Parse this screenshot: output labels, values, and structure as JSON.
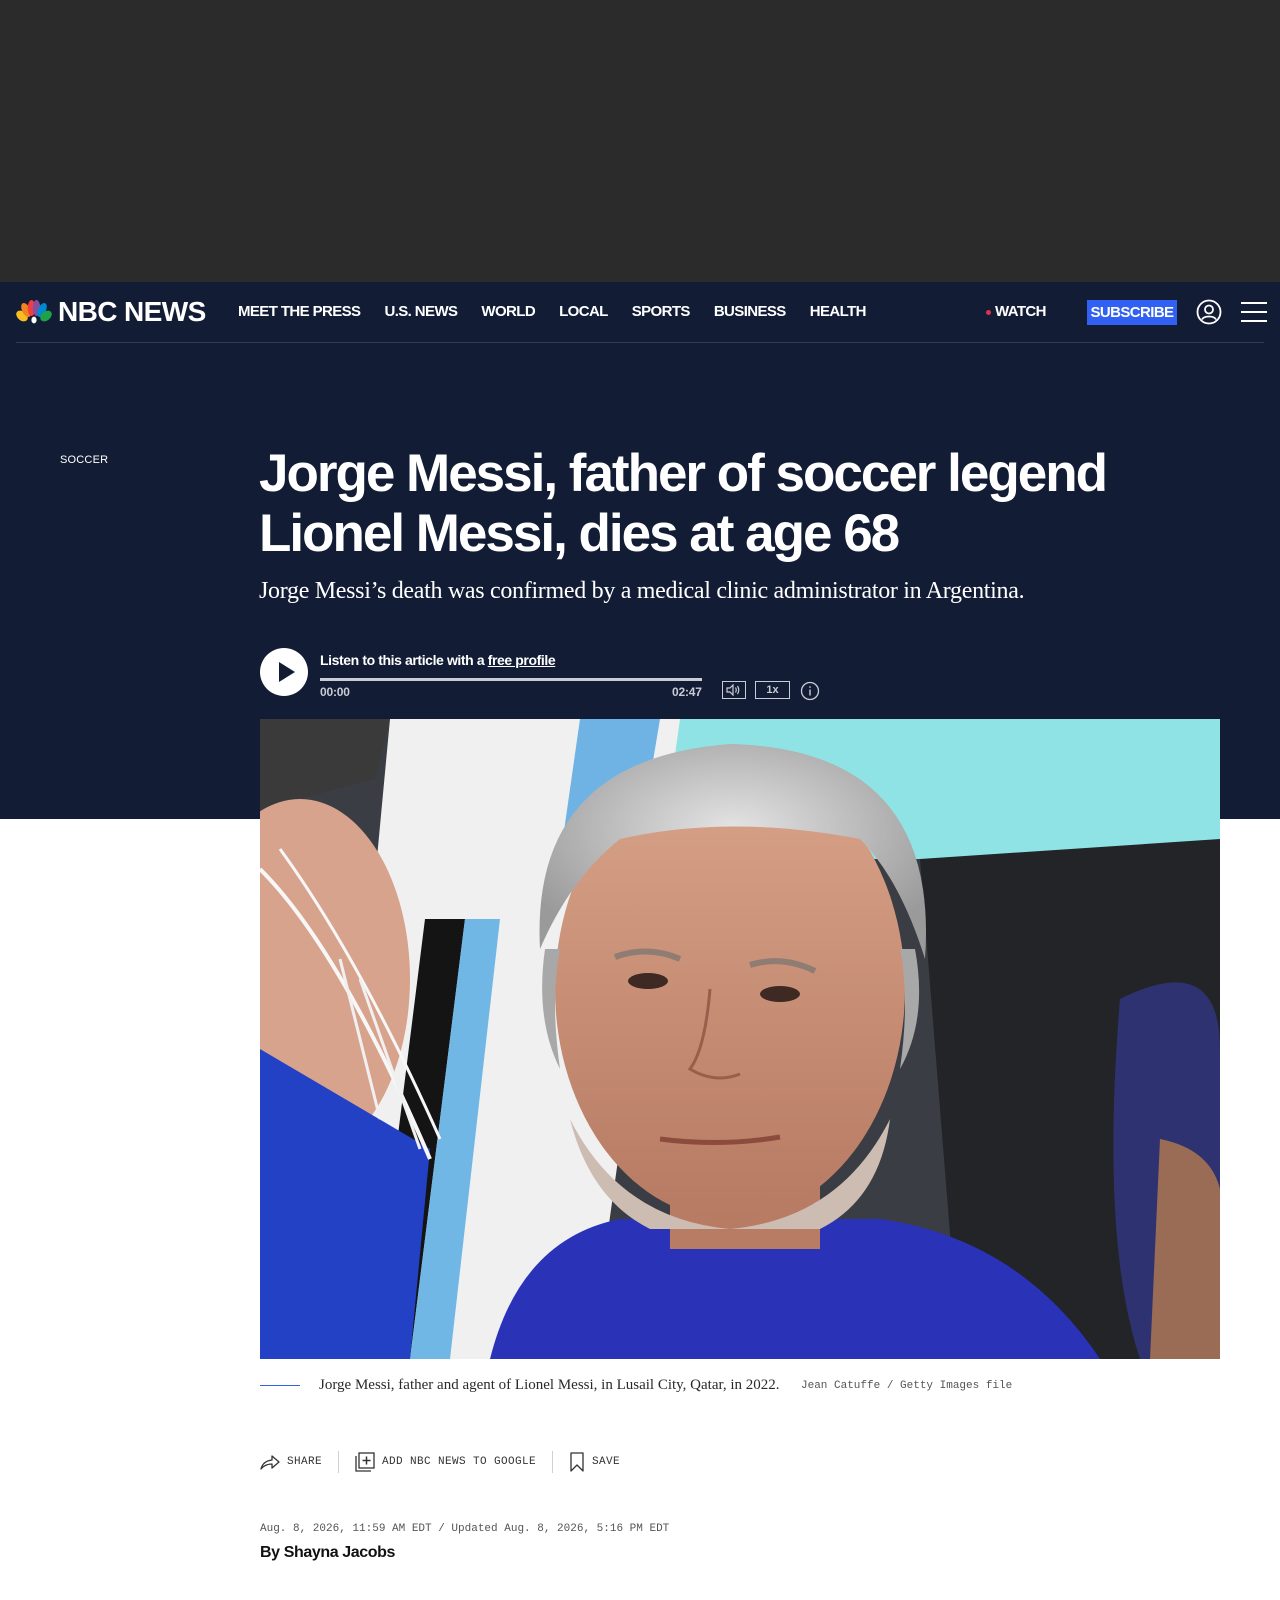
{
  "brand": {
    "name": "NBC NEWS",
    "peacock_colors": [
      "#f8bd22",
      "#f58220",
      "#ef3e42",
      "#8a4d9e",
      "#0089cf",
      "#1ea248"
    ]
  },
  "nav": {
    "links": [
      "MEET THE PRESS",
      "U.S. NEWS",
      "WORLD",
      "LOCAL",
      "SPORTS",
      "BUSINESS",
      "HEALTH"
    ],
    "watch_label": "WATCH",
    "subscribe_label": "SUBSCRIBE"
  },
  "article": {
    "section": "SOCCER",
    "headline": "Jorge Messi, father of soccer legend Lionel Messi, dies at age 68",
    "dek": "Jorge Messi’s death was confirmed by a medical clinic administrator in Argentina.",
    "audio": {
      "prompt": "Listen to this article with a ",
      "prompt_link": "free profile",
      "current_time": "00:00",
      "duration": "02:47",
      "progress": 0,
      "speed": "1x"
    },
    "image": {
      "caption": "Jorge Messi, father and agent of Lionel Messi, in Lusail City, Qatar, in 2022.",
      "credit": "Jean Catuffe / Getty Images file"
    },
    "share": {
      "share_label": "SHARE",
      "google_label": "ADD NBC NEWS TO GOOGLE",
      "save_label": "SAVE"
    },
    "dateline": "Aug. 8, 2026, 11:59 AM EDT / Updated Aug. 8, 2026, 5:16 PM EDT",
    "byline_prefix": "By ",
    "author": "Shayna Jacobs"
  },
  "colors": {
    "header_bg": "#121d35",
    "ad_bg": "#2b2b2b",
    "accent": "#3061f2",
    "live": "#e0314b"
  },
  "icons": [
    "peacock-logo-icon",
    "live-dot-icon",
    "account-icon",
    "hamburger-icon",
    "play-icon",
    "volume-icon",
    "info-icon",
    "share-icon",
    "add-google-icon",
    "bookmark-icon"
  ]
}
